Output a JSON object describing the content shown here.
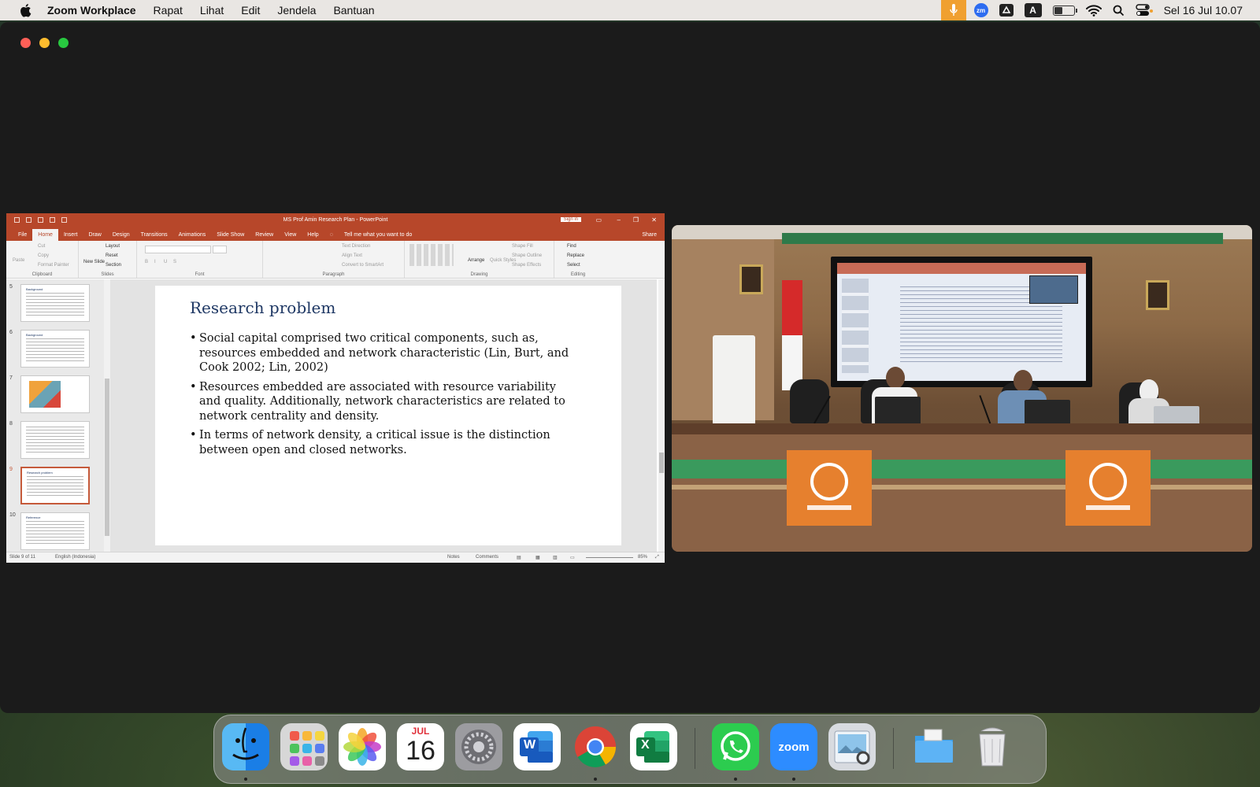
{
  "menubar": {
    "app_name": "Zoom Workplace",
    "menus": [
      "Rapat",
      "Lihat",
      "Edit",
      "Jendela",
      "Bantuan"
    ],
    "zm_badge": "zm",
    "keyboard_badge": "A",
    "clock": "Sel 16 Jul  10.07",
    "battery_level": 0.45
  },
  "ppt": {
    "doc_title": "MS Prof Amin Research Plan  -  PowerPoint",
    "sign_in": "Sign in",
    "tabs": [
      "File",
      "Home",
      "Insert",
      "Draw",
      "Design",
      "Transitions",
      "Animations",
      "Slide Show",
      "Review",
      "View",
      "Help"
    ],
    "active_tab": "Home",
    "tell_me": "Tell me what you want to do",
    "share": "Share",
    "ribbon": {
      "clipboard": {
        "label": "Clipboard",
        "paste": "Paste",
        "cut": "Cut",
        "copy": "Copy",
        "format_painter": "Format Painter"
      },
      "slides": {
        "label": "Slides",
        "new_slide": "New Slide",
        "layout": "Layout",
        "reset": "Reset",
        "section": "Section"
      },
      "font": {
        "label": "Font"
      },
      "paragraph": {
        "label": "Paragraph",
        "text_direction": "Text Direction",
        "align_text": "Align Text",
        "convert_smartart": "Convert to SmartArt"
      },
      "drawing": {
        "label": "Drawing",
        "arrange": "Arrange",
        "quick_styles": "Quick Styles",
        "shape_fill": "Shape Fill",
        "shape_outline": "Shape Outline",
        "shape_effects": "Shape Effects"
      },
      "editing": {
        "label": "Editing",
        "find": "Find",
        "replace": "Replace",
        "select": "Select"
      }
    },
    "thumbnails": [
      {
        "num": "5",
        "title": "Background"
      },
      {
        "num": "6",
        "title": "Background"
      },
      {
        "num": "7",
        "title": ""
      },
      {
        "num": "8",
        "title": ""
      },
      {
        "num": "9",
        "title": "Research problem"
      },
      {
        "num": "10",
        "title": "Reference"
      }
    ],
    "slide": {
      "title": "Research problem",
      "bullets": [
        "Social capital comprised two critical components, such as, resources embedded and network characteristic (Lin, Burt, and Cook 2002; Lin, 2002)",
        "Resources embedded are associated with resource variability and quality. Additionally, network characteristics are related to network centrality and density.",
        "In terms of network density, a critical issue is the distinction between open and closed networks."
      ]
    },
    "status": {
      "slide_of": "Slide 9 of 11",
      "language": "English (Indonesia)",
      "notes": "Notes",
      "comments": "Comments",
      "zoom": "85%"
    }
  },
  "dock": {
    "calendar_month": "JUL",
    "calendar_day": "16",
    "zoom_label": "zoom",
    "word_letter": "W",
    "excel_letter": "X"
  },
  "colors": {
    "ppt_accent": "#b7472a",
    "slide_title": "#1f3864",
    "mic_active": "#f0a030"
  }
}
